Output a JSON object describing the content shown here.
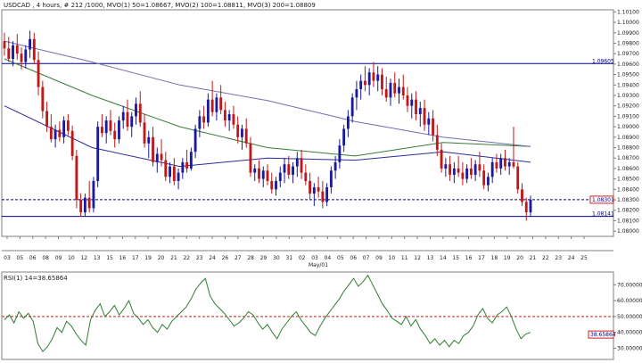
{
  "header": {
    "title": "USDCAD , 4 hours, # 212 /1000, MVO(1) 50=1.08667, MVO(2) 100=1.08811, MVO(3) 200=1.08809",
    "rsi_title": "RSI(1) 14=38.65864"
  },
  "colors": {
    "background": "#ffffff",
    "frame": "#7f7f7f",
    "bull_candle": "#1a1aa0",
    "bear_candle": "#c01818",
    "ma50": "#2a2a9c",
    "ma100": "#3a7a3a",
    "ma200": "#7070b0",
    "rsi_line": "#2e7d2e",
    "rsi_50_line": "#c02020",
    "hline": "#000080"
  },
  "chart_data": [
    {
      "type": "candlestick",
      "title": "USDCAD , 4 hours, # 212 /1000, MVO(1) 50=1.08667, MVO(2) 100=1.08811, MVO(3) 200=1.08809",
      "x_tick_labels": [
        "03",
        "05",
        "06",
        "08",
        "09",
        "10",
        "12",
        "13",
        "15",
        "16",
        "17",
        "19",
        "20",
        "21",
        "22",
        "23",
        "24",
        "26",
        "27",
        "28",
        "29",
        "30",
        "31",
        "02",
        "03",
        "04",
        "05",
        "06",
        "07",
        "09",
        "10",
        "11",
        "12",
        "13",
        "14",
        "15",
        "16",
        "17",
        "18",
        "19",
        "20",
        "21",
        "22",
        "23",
        "24",
        "25"
      ],
      "x_sublabel": "May/01",
      "y_tick_labels": [
        "1.08000",
        "1.08100",
        "1.08200",
        "1.08300",
        "1.08400",
        "1.08500",
        "1.08600",
        "1.08700",
        "1.08800",
        "1.08900",
        "1.09000",
        "1.09100",
        "1.09200",
        "1.09300",
        "1.09400",
        "1.09500",
        "1.09600",
        "1.09700",
        "1.09800",
        "1.09900",
        "1.10000",
        "1.10100"
      ],
      "ylim": [
        1.0795,
        1.1012
      ],
      "horizontal_lines": [
        {
          "label": "1.09605",
          "value": 1.09605
        },
        {
          "label": "1.08301",
          "value": 1.08301
        },
        {
          "label": "1.08141",
          "value": 1.08141
        }
      ],
      "candles": [
        [
          1.0982,
          1.099,
          1.0968,
          1.0975
        ],
        [
          1.0975,
          1.0986,
          1.0962,
          1.0965
        ],
        [
          1.0965,
          1.0982,
          1.0958,
          1.0978
        ],
        [
          1.0978,
          1.0989,
          1.0964,
          1.097
        ],
        [
          1.097,
          1.0976,
          1.0955,
          1.0962
        ],
        [
          1.0962,
          1.0978,
          1.0956,
          1.0974
        ],
        [
          1.0974,
          1.0992,
          1.0966,
          1.0984
        ],
        [
          1.0984,
          1.099,
          1.096,
          1.0964
        ],
        [
          1.0964,
          1.0972,
          1.093,
          1.0938
        ],
        [
          1.0938,
          1.0944,
          1.0908,
          1.0915
        ],
        [
          1.0915,
          1.0924,
          1.0895,
          1.09
        ],
        [
          1.09,
          1.0912,
          1.0885,
          1.0888
        ],
        [
          1.0888,
          1.0902,
          1.088,
          1.0897
        ],
        [
          1.0897,
          1.0905,
          1.0886,
          1.089
        ],
        [
          1.089,
          1.091,
          1.0884,
          1.0906
        ],
        [
          1.0906,
          1.0912,
          1.0892,
          1.0896
        ],
        [
          1.0896,
          1.0901,
          1.0868,
          1.0872
        ],
        [
          1.0872,
          1.0878,
          1.0822,
          1.083
        ],
        [
          1.083,
          1.0836,
          1.0814,
          1.0818
        ],
        [
          1.0818,
          1.0836,
          1.0814,
          1.0832
        ],
        [
          1.0832,
          1.0848,
          1.0818,
          1.0822
        ],
        [
          1.0822,
          1.0852,
          1.0818,
          1.0848
        ],
        [
          1.0848,
          1.0905,
          1.0842,
          1.09
        ],
        [
          1.09,
          1.0912,
          1.089,
          1.0894
        ],
        [
          1.0894,
          1.091,
          1.0884,
          1.0906
        ],
        [
          1.0906,
          1.0916,
          1.0892,
          1.0896
        ],
        [
          1.0896,
          1.0904,
          1.088,
          1.0888
        ],
        [
          1.0888,
          1.091,
          1.0884,
          1.0906
        ],
        [
          1.0906,
          1.092,
          1.0898,
          1.0914
        ],
        [
          1.0914,
          1.0926,
          1.0896,
          1.09
        ],
        [
          1.09,
          1.0914,
          1.089,
          1.091
        ],
        [
          1.091,
          1.0928,
          1.0902,
          1.0922
        ],
        [
          1.0922,
          1.0934,
          1.09,
          1.0904
        ],
        [
          1.0904,
          1.0912,
          1.088,
          1.0884
        ],
        [
          1.0884,
          1.0896,
          1.087,
          1.089
        ],
        [
          1.089,
          1.09,
          1.0862,
          1.0866
        ],
        [
          1.0866,
          1.088,
          1.0856,
          1.0874
        ],
        [
          1.0874,
          1.0888,
          1.0862,
          1.0868
        ],
        [
          1.0868,
          1.0876,
          1.0848,
          1.0852
        ],
        [
          1.0852,
          1.0866,
          1.0846,
          1.0862
        ],
        [
          1.0862,
          1.087,
          1.0844,
          1.0848
        ],
        [
          1.0848,
          1.086,
          1.084,
          1.0856
        ],
        [
          1.0856,
          1.087,
          1.085,
          1.0866
        ],
        [
          1.0866,
          1.0878,
          1.0856,
          1.086
        ],
        [
          1.086,
          1.088,
          1.0858,
          1.0876
        ],
        [
          1.0876,
          1.0902,
          1.087,
          1.0898
        ],
        [
          1.0898,
          1.0916,
          1.089,
          1.091
        ],
        [
          1.091,
          1.092,
          1.0898,
          1.0904
        ],
        [
          1.0904,
          1.0932,
          1.09,
          1.0926
        ],
        [
          1.0926,
          1.0944,
          1.091,
          1.0914
        ],
        [
          1.0914,
          1.0932,
          1.0906,
          1.0928
        ],
        [
          1.0928,
          1.094,
          1.0912,
          1.0916
        ],
        [
          1.0916,
          1.0924,
          1.09,
          1.0906
        ],
        [
          1.0906,
          1.0916,
          1.0896,
          1.0912
        ],
        [
          1.0912,
          1.092,
          1.0898,
          1.0902
        ],
        [
          1.0902,
          1.091,
          1.0884,
          1.089
        ],
        [
          1.089,
          1.0902,
          1.0878,
          1.0898
        ],
        [
          1.0898,
          1.0908,
          1.088,
          1.0884
        ],
        [
          1.0884,
          1.089,
          1.0852,
          1.0856
        ],
        [
          1.0856,
          1.0864,
          1.0848,
          1.086
        ],
        [
          1.086,
          1.0868,
          1.0846,
          1.085
        ],
        [
          1.085,
          1.0862,
          1.0842,
          1.0858
        ],
        [
          1.0858,
          1.0864,
          1.0844,
          1.0848
        ],
        [
          1.0848,
          1.0856,
          1.0836,
          1.084
        ],
        [
          1.084,
          1.0852,
          1.0834,
          1.0848
        ],
        [
          1.0848,
          1.0862,
          1.0842,
          1.0856
        ],
        [
          1.0856,
          1.087,
          1.0846,
          1.0864
        ],
        [
          1.0864,
          1.0872,
          1.085,
          1.0854
        ],
        [
          1.0854,
          1.0866,
          1.0846,
          1.0862
        ],
        [
          1.0862,
          1.0876,
          1.0852,
          1.087
        ],
        [
          1.087,
          1.0878,
          1.085,
          1.0856
        ],
        [
          1.0856,
          1.0864,
          1.0844,
          1.0848
        ],
        [
          1.0848,
          1.0856,
          1.083,
          1.0836
        ],
        [
          1.0836,
          1.0846,
          1.0824,
          1.0842
        ],
        [
          1.0842,
          1.0852,
          1.0832,
          1.0838
        ],
        [
          1.0838,
          1.0848,
          1.0822,
          1.0828
        ],
        [
          1.0828,
          1.0846,
          1.0824,
          1.0842
        ],
        [
          1.0842,
          1.0862,
          1.0836,
          1.0858
        ],
        [
          1.0858,
          1.0872,
          1.085,
          1.0866
        ],
        [
          1.0866,
          1.0888,
          1.086,
          1.0882
        ],
        [
          1.0882,
          1.0902,
          1.0876,
          1.0898
        ],
        [
          1.0898,
          1.0916,
          1.089,
          1.091
        ],
        [
          1.091,
          1.0932,
          1.0904,
          1.0928
        ],
        [
          1.0928,
          1.0944,
          1.0916,
          1.0936
        ],
        [
          1.0936,
          1.095,
          1.0926,
          1.0944
        ],
        [
          1.0944,
          1.0958,
          1.0934,
          1.094
        ],
        [
          1.094,
          1.0956,
          1.093,
          1.0952
        ],
        [
          1.0952,
          1.0962,
          1.0938,
          1.0944
        ],
        [
          1.0944,
          1.0958,
          1.0934,
          1.095
        ],
        [
          1.095,
          1.0956,
          1.093,
          1.0936
        ],
        [
          1.0936,
          1.0948,
          1.0924,
          1.0928
        ],
        [
          1.0928,
          1.0946,
          1.092,
          1.0942
        ],
        [
          1.0942,
          1.0952,
          1.0928,
          1.0932
        ],
        [
          1.0932,
          1.0946,
          1.0922,
          1.0938
        ],
        [
          1.0938,
          1.095,
          1.0926,
          1.093
        ],
        [
          1.093,
          1.0938,
          1.0914,
          1.092
        ],
        [
          1.092,
          1.0932,
          1.0908,
          1.0926
        ],
        [
          1.0926,
          1.0934,
          1.0906,
          1.0912
        ],
        [
          1.0912,
          1.0924,
          1.09,
          1.0918
        ],
        [
          1.0918,
          1.0926,
          1.0896,
          1.0902
        ],
        [
          1.0902,
          1.0914,
          1.0892,
          1.0908
        ],
        [
          1.0908,
          1.0916,
          1.0886,
          1.0892
        ],
        [
          1.0892,
          1.0902,
          1.0872,
          1.0878
        ],
        [
          1.0878,
          1.0884,
          1.0856,
          1.086
        ],
        [
          1.086,
          1.087,
          1.0852,
          1.0864
        ],
        [
          1.0864,
          1.0872,
          1.0848,
          1.0854
        ],
        [
          1.0854,
          1.0866,
          1.0846,
          1.086
        ],
        [
          1.086,
          1.0872,
          1.0852,
          1.0856
        ],
        [
          1.0856,
          1.0866,
          1.0844,
          1.085
        ],
        [
          1.085,
          1.0864,
          1.0846,
          1.086
        ],
        [
          1.086,
          1.087,
          1.085,
          1.0854
        ],
        [
          1.0854,
          1.0868,
          1.0848,
          1.0864
        ],
        [
          1.0864,
          1.0876,
          1.0852,
          1.0858
        ],
        [
          1.0858,
          1.0864,
          1.084,
          1.0844
        ],
        [
          1.0844,
          1.0856,
          1.0838,
          1.0852
        ],
        [
          1.0852,
          1.087,
          1.0846,
          1.0866
        ],
        [
          1.0866,
          1.0874,
          1.0856,
          1.086
        ],
        [
          1.086,
          1.0874,
          1.0854,
          1.087
        ],
        [
          1.087,
          1.0878,
          1.0858,
          1.0862
        ],
        [
          1.0862,
          1.087,
          1.0854,
          1.0866
        ],
        [
          1.0866,
          1.09,
          1.086,
          1.0862
        ],
        [
          1.0862,
          1.0866,
          1.0836,
          1.084
        ],
        [
          1.084,
          1.0846,
          1.0824,
          1.0828
        ],
        [
          1.0828,
          1.0832,
          1.081,
          1.0818
        ],
        [
          1.0818,
          1.0834,
          1.0814,
          1.083
        ]
      ],
      "series": [
        {
          "name": "MVO(1) 50",
          "values": [
            1.092,
            1.088,
            1.0862,
            1.087,
            1.0868,
            1.0876,
            1.0866
          ]
        },
        {
          "name": "MVO(2) 100",
          "values": [
            1.0965,
            1.093,
            1.09,
            1.088,
            1.0872,
            1.0885,
            1.0881
          ]
        },
        {
          "name": "MVO(3) 200",
          "values": [
            1.0982,
            1.0962,
            1.094,
            1.0925,
            1.0905,
            1.089,
            1.0881
          ]
        }
      ]
    },
    {
      "type": "line",
      "title": "RSI(1) 14=38.65864",
      "y_tick_labels": [
        "30.00000",
        "40.00000",
        "50.00000",
        "60.00000",
        "70.00000"
      ],
      "ylim": [
        23,
        78
      ],
      "horizontal_lines": [
        {
          "label": "50",
          "value": 50
        },
        {
          "label": "38.65864",
          "value": 38.65864
        }
      ],
      "series": [
        {
          "name": "RSI(1) 14",
          "values": [
            48,
            51,
            46,
            53,
            49,
            52,
            47,
            33,
            28,
            31,
            36,
            43,
            40,
            47,
            44,
            39,
            35,
            32,
            48,
            54,
            58,
            50,
            53,
            57,
            51,
            55,
            60,
            52,
            49,
            45,
            48,
            43,
            40,
            45,
            42,
            47,
            50,
            53,
            56,
            61,
            67,
            71,
            74,
            63,
            58,
            55,
            52,
            48,
            44,
            46,
            49,
            53,
            51,
            46,
            42,
            45,
            40,
            36,
            42,
            46,
            50,
            53,
            48,
            44,
            40,
            38,
            44,
            49,
            53,
            57,
            61,
            66,
            70,
            74,
            69,
            72,
            76,
            70,
            64,
            58,
            54,
            49,
            47,
            45,
            50,
            44,
            48,
            42,
            38,
            33,
            36,
            32,
            35,
            31,
            35,
            33,
            38,
            40,
            44,
            51,
            55,
            49,
            46,
            51,
            53,
            56,
            50,
            42,
            36,
            39,
            40
          ]
        }
      ]
    }
  ]
}
